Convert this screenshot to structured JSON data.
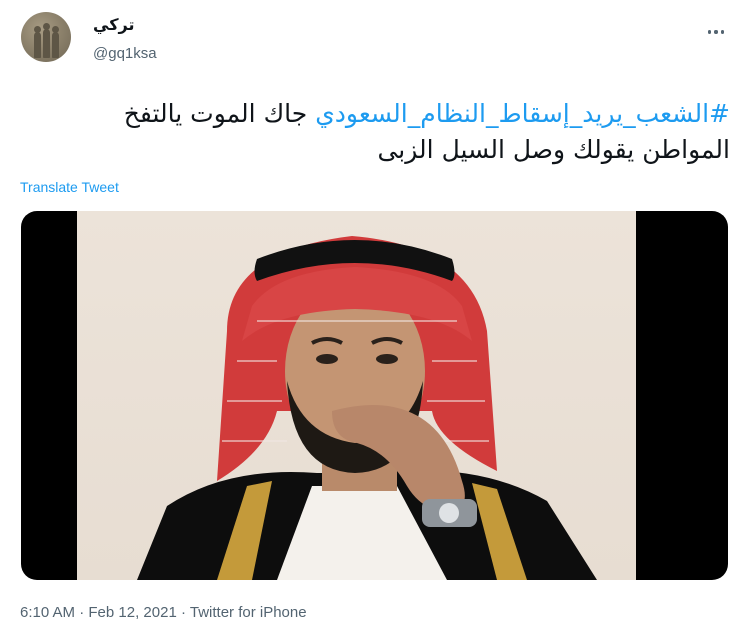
{
  "author": {
    "display_name": "تركي",
    "handle": "@gq1ksa"
  },
  "tweet": {
    "hashtag": "#الشعب_يريد_إسقاط_النظام_السعودي",
    "text_line1": " جاك الموت يالتفخ",
    "text_line2": "المواطن يقولك وصل السيل الزبى",
    "translate_label": "Translate Tweet"
  },
  "media": {
    "alt": "photo"
  },
  "meta": {
    "time": "6:10 AM",
    "separator": " · ",
    "date": "Feb 12, 2021",
    "source": "Twitter for iPhone"
  },
  "colors": {
    "link": "#1d9bf0",
    "text": "#0f1419",
    "muted": "#536471"
  },
  "icons": {
    "more": "more-horizontal-icon"
  }
}
